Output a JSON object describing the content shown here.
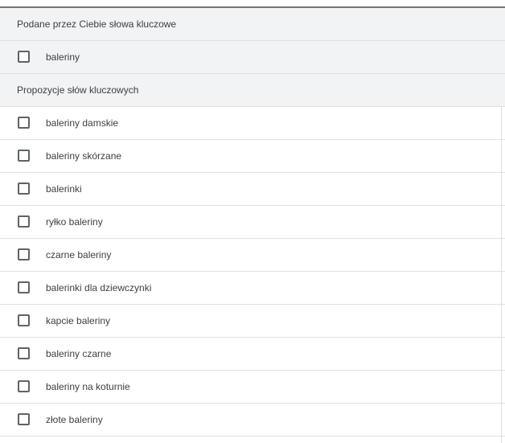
{
  "provided": {
    "header": "Podane przez Ciebie słowa kluczowe",
    "items": [
      {
        "label": "baleriny",
        "checked": false
      }
    ]
  },
  "suggestions": {
    "header": "Propozycje słów kluczowych",
    "items": [
      {
        "label": "baleriny damskie",
        "checked": false
      },
      {
        "label": "baleriny skórzane",
        "checked": false
      },
      {
        "label": "balerinki",
        "checked": false
      },
      {
        "label": "ryłko baleriny",
        "checked": false
      },
      {
        "label": "czarne baleriny",
        "checked": false
      },
      {
        "label": "balerinki dla dziewczynki",
        "checked": false
      },
      {
        "label": "kapcie baleriny",
        "checked": false
      },
      {
        "label": "baleriny czarne",
        "checked": false
      },
      {
        "label": "baleriny na koturnie",
        "checked": false
      },
      {
        "label": "złote baleriny",
        "checked": false
      }
    ]
  },
  "colors": {
    "header_bg": "#f1f3f4",
    "divider": "#e0e0e0",
    "checkbox_border": "#5f6368",
    "text": "#3c4043"
  }
}
